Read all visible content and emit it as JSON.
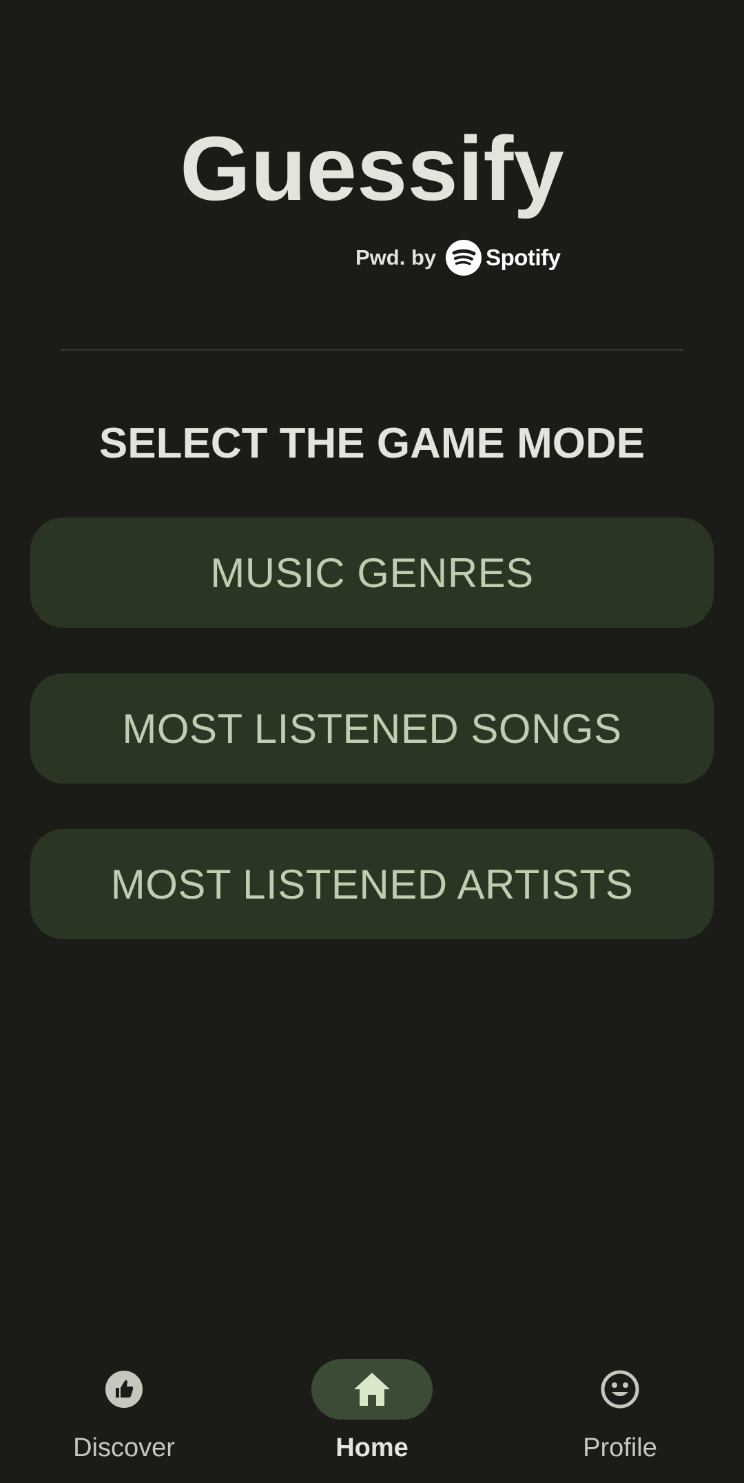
{
  "app": {
    "title": "Guessify",
    "powered_by": "Pwd. by",
    "powered_brand": "Spotify"
  },
  "main": {
    "heading": "SELECT THE GAME MODE",
    "modes": [
      {
        "label": "MUSIC GENRES"
      },
      {
        "label": "MOST LISTENED SONGS"
      },
      {
        "label": "MOST LISTENED ARTISTS"
      }
    ]
  },
  "nav": {
    "items": [
      {
        "label": "Discover",
        "icon": "thumb-up-icon",
        "selected": false
      },
      {
        "label": "Home",
        "icon": "home-icon",
        "selected": true
      },
      {
        "label": "Profile",
        "icon": "smiley-face-icon",
        "selected": false
      }
    ]
  },
  "colors": {
    "background": "#1b1c18",
    "button_background": "#2b3523",
    "button_text": "#bfcdb0",
    "nav_active_indicator": "#3c4b36",
    "title_text": "#e4e3dc",
    "spotify_logo": "#ffffff"
  }
}
